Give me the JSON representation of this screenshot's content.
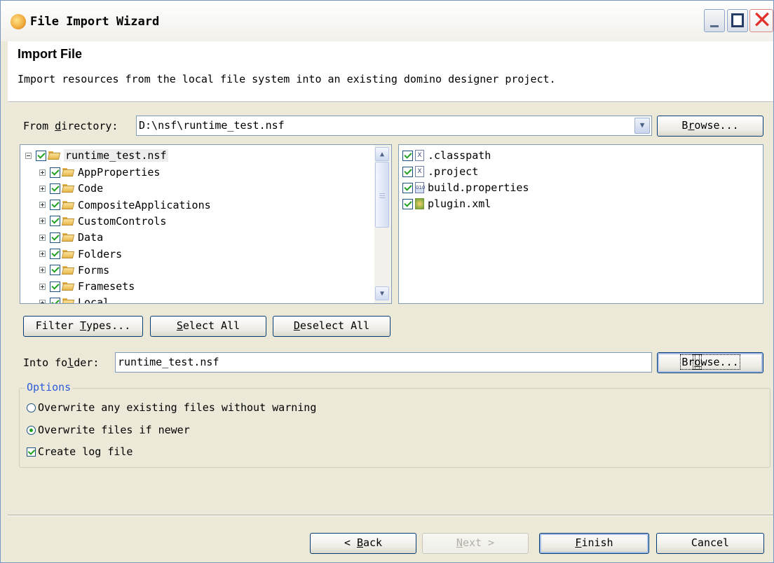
{
  "window": {
    "title": "File Import Wizard"
  },
  "header": {
    "title": "Import File",
    "description": "Import resources from the local file system into an existing domino designer project."
  },
  "from_directory": {
    "label_pre": "From ",
    "label_accel": "d",
    "label_post": "irectory:",
    "value": "D:\\nsf\\runtime_test.nsf",
    "browse_pre": "B",
    "browse_accel": "r",
    "browse_post": "owse..."
  },
  "tree": {
    "root": "runtime_test.nsf",
    "items": [
      "AppProperties",
      "Code",
      "CompositeApplications",
      "CustomControls",
      "Data",
      "Folders",
      "Forms",
      "Framesets",
      "Local"
    ]
  },
  "files": [
    {
      "name": ".classpath",
      "icon": "xml-file-icon"
    },
    {
      "name": ".project",
      "icon": "xml-file-icon"
    },
    {
      "name": "build.properties",
      "icon": "properties-file-icon"
    },
    {
      "name": "plugin.xml",
      "icon": "plugin-file-icon"
    }
  ],
  "buttons": {
    "filter_pre": "Filter ",
    "filter_accel": "T",
    "filter_post": "ypes...",
    "select_accel": "S",
    "select_post": "elect All",
    "deselect_accel": "D",
    "deselect_post": "eselect All",
    "back_pre": "< ",
    "back_accel": "B",
    "back_post": "ack",
    "next_pre": "",
    "next_accel": "N",
    "next_post": "ext >",
    "finish_accel": "F",
    "finish_post": "inish",
    "cancel": "Cancel"
  },
  "into_folder": {
    "label_pre": "Into fo",
    "label_accel": "l",
    "label_post": "der:",
    "value": "runtime_test.nsf",
    "browse_pre": "Br",
    "browse_accel": "o",
    "browse_post": "wse..."
  },
  "options": {
    "title": "Options",
    "overwrite_all": "Overwrite any existing files without warning",
    "overwrite_all_selected": false,
    "overwrite_newer": "Overwrite files if newer",
    "overwrite_newer_selected": true,
    "create_log": "Create log file",
    "create_log_checked": true
  },
  "colors": {
    "window_bg": "#ece9d8",
    "option_title": "#2c5bd8",
    "check_mark": "#21a121",
    "close_button": "#e2312a"
  }
}
